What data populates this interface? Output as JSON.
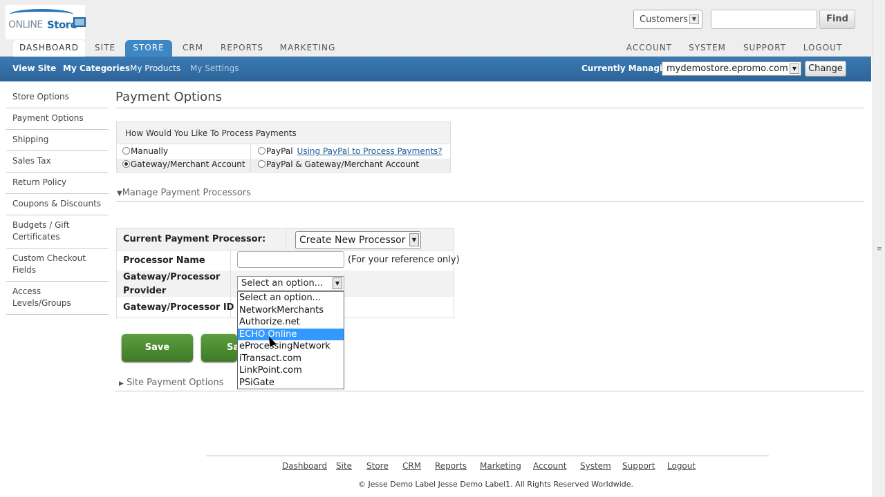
{
  "header": {
    "logo_text_1": "ONLINE",
    "logo_text_2": "Store",
    "customer_select": "Customers",
    "search_value": "",
    "find_label": "Find",
    "tabs": [
      "DASHBOARD",
      "SITE",
      "STORE",
      "CRM",
      "REPORTS",
      "MARKETING"
    ],
    "right_tabs": [
      "ACCOUNT",
      "SYSTEM",
      "SUPPORT",
      "LOGOUT"
    ],
    "active_tab": "STORE"
  },
  "subnav": {
    "links": [
      "View Site",
      "My Categories",
      "My Products",
      "My Settings"
    ],
    "managing_label": "Currently Managing:",
    "managing_value": "mydemostore.epromo.com",
    "change_label": "Change"
  },
  "sidebar": {
    "items": [
      "Store Options",
      "Payment Options",
      "Shipping",
      "Sales Tax",
      "Return Policy",
      "Coupons & Discounts",
      "Budgets / Gift Certificates",
      "Custom Checkout Fields",
      "Access Levels/Groups"
    ],
    "active": "Payment Options"
  },
  "main": {
    "title": "Payment Options",
    "process": {
      "heading": "How Would You Like To Process Payments",
      "opt_manual": "Manually",
      "opt_paypal": "PayPal",
      "paypal_link": "Using PayPal to Process Payments?",
      "opt_gateway": "Gateway/Merchant Account",
      "opt_paypal_gateway": "PayPal & Gateway/Merchant Account",
      "selected": "Gateway/Merchant Account"
    },
    "manage_heading": "Manage Payment Processors",
    "processor": {
      "current_label": "Current Payment Processor:",
      "current_value": "Create New Processor",
      "name_label": "Processor Name",
      "name_value": "",
      "name_note": "(For your reference only)",
      "provider_label_1": "Gateway/Processor",
      "provider_label_2": "Provider",
      "provider_value": "Select an option...",
      "id_label": "Gateway/Processor ID",
      "options": [
        "Select an option...",
        "NetworkMerchants",
        "Authorize.net",
        "ECHO Online",
        "eProcessingNetwork",
        "iTransact.com",
        "LinkPoint.com",
        "PSiGate"
      ],
      "highlighted": "ECHO Online"
    },
    "save_label": "Save",
    "save2_label": "Sa",
    "site_heading": "Site Payment Options"
  },
  "footer": {
    "links": [
      "Dashboard",
      "Site",
      "Store",
      "CRM",
      "Reports",
      "Marketing",
      "Account",
      "System",
      "Support",
      "Logout"
    ],
    "copyright": "© Jesse Demo Label Jesse Demo Label1. All Rights Reserved Worldwide."
  },
  "colors": {
    "accent_blue": "#3d88c4",
    "subnav_blue": "#2d6498",
    "save_green": "#4c8c32",
    "dropdown_highlight": "#3399ff"
  }
}
